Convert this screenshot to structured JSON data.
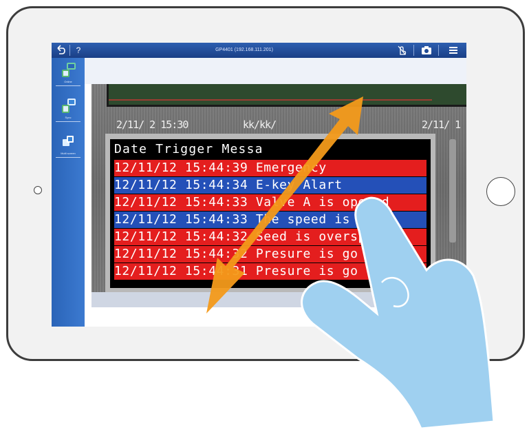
{
  "topbar": {
    "back_icon": "back-arrow-icon",
    "help_label": "?",
    "title": "GP4401 (192.168.111.201)",
    "touch_icon": "touch-gesture-icon",
    "camera_icon": "camera-icon",
    "menu_icon": "hamburger-menu-icon"
  },
  "sidebar": {
    "items": [
      {
        "label": "Online",
        "icon": "online-icon"
      },
      {
        "label": "Sync",
        "icon": "sync-icon"
      },
      {
        "label": "Multi screen",
        "icon": "multi-screen-icon"
      }
    ]
  },
  "hmi": {
    "stamp_left": "2/11/ 2 15:30",
    "stamp_mid": "kk/kk/",
    "stamp_right": "2/11/ 1",
    "header": "Date     Trigger Messa",
    "rows": [
      {
        "text": "12/11/12 15:44:39 Emergency",
        "color": "red"
      },
      {
        "text": "12/11/12 15:44:34 E-key Alart",
        "color": "blue"
      },
      {
        "text": "12/11/12 15:44:33 Valve A is opened",
        "color": "red"
      },
      {
        "text": "12/11/12 15:44:33 The speed  is sett",
        "color": "blue"
      },
      {
        "text": "12/11/12 15:44:32 Seed is overspeed",
        "color": "red"
      },
      {
        "text": "12/11/12 15:44:32 Presure is go",
        "color": "red"
      },
      {
        "text": "12/11/12 15:44:31 Presure is go",
        "color": "red"
      }
    ]
  },
  "colors": {
    "row_red": "#e41e1e",
    "row_blue": "#2450b8",
    "arrow": "#f39a1a",
    "hand": "#9fd0f0"
  },
  "gesture": {
    "arrow_icon": "pinch-zoom-double-arrow-icon",
    "hand_icon": "hand-pointer-icon"
  }
}
